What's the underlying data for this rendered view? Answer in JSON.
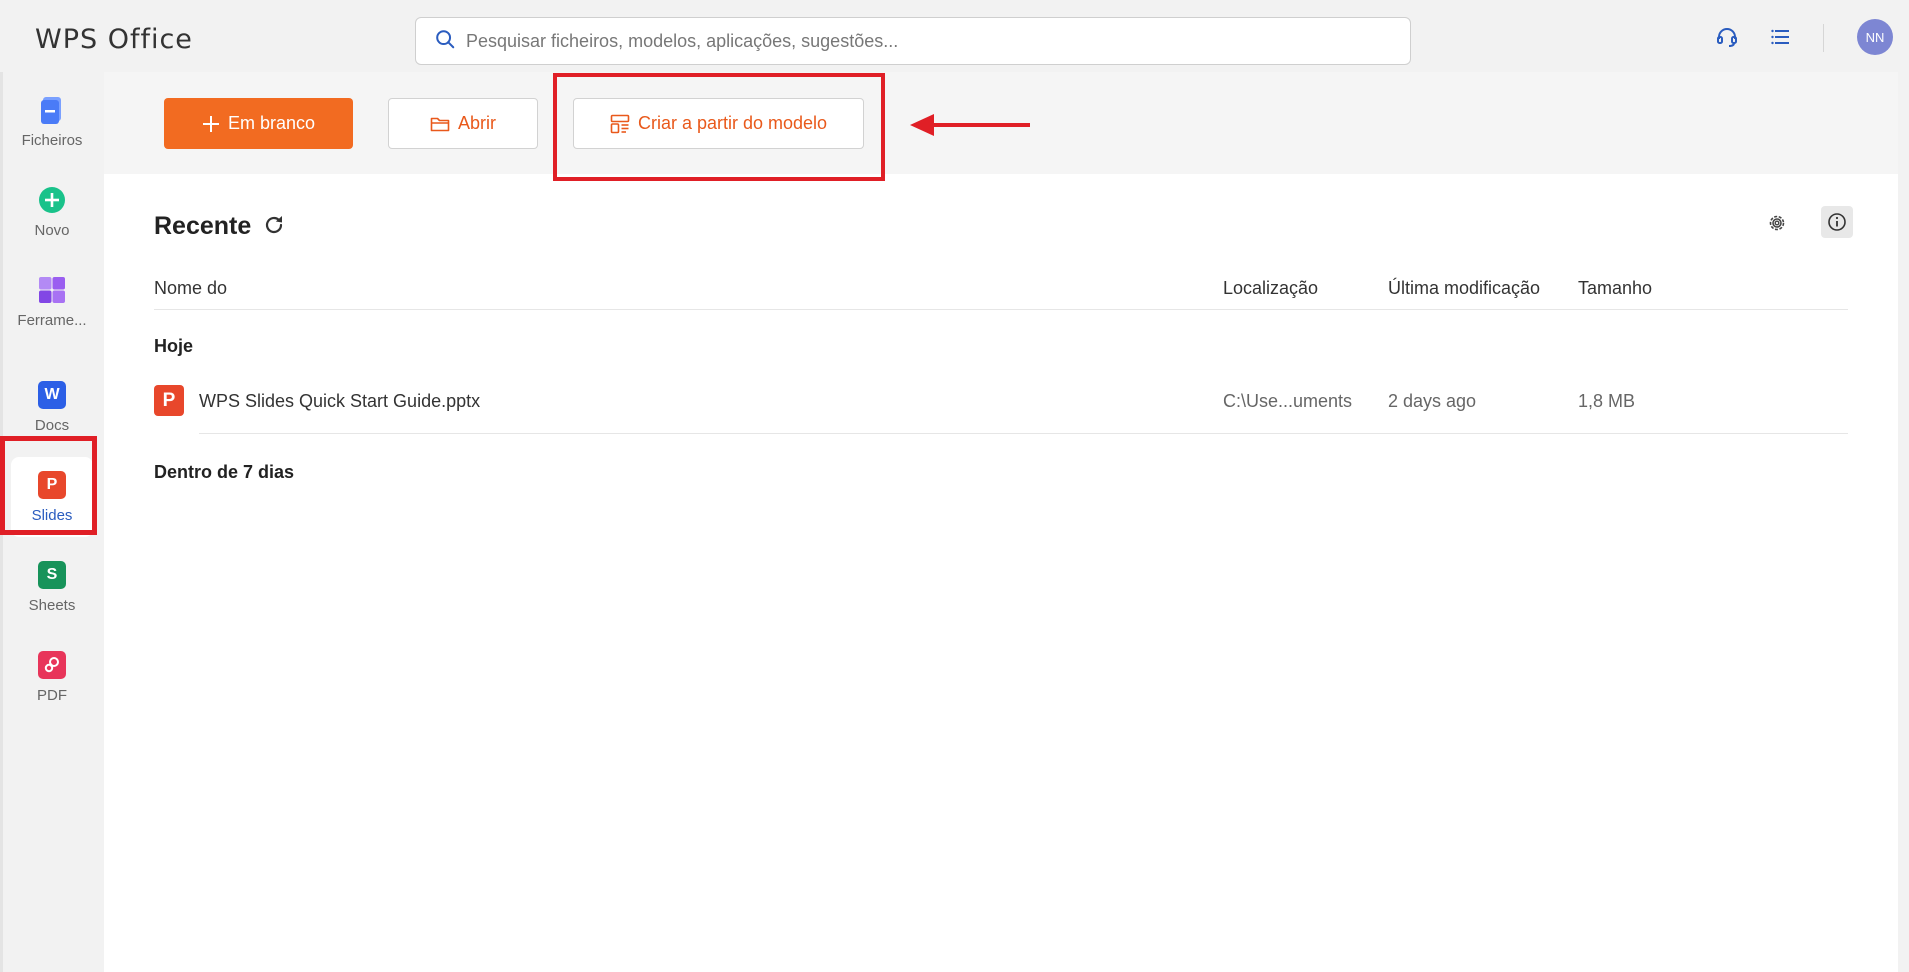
{
  "app": {
    "logo_text": "WPS Office"
  },
  "search": {
    "placeholder": "Pesquisar ficheiros, modelos, aplicações, sugestões..."
  },
  "user": {
    "initials": "NN"
  },
  "sidebar": {
    "items": [
      {
        "label": "Ficheiros",
        "icon": "files-icon",
        "color": "#4a7bf7"
      },
      {
        "label": "Novo",
        "icon": "plus-circle-icon",
        "color": "#19c28a"
      },
      {
        "label": "Ferrame...",
        "icon": "tools-icon",
        "color": "#9a5ef0"
      },
      {
        "label": "Docs",
        "icon": "docs-icon",
        "color": "#2c5fe6",
        "glyph": "W"
      },
      {
        "label": "Slides",
        "icon": "slides-icon",
        "color": "#e8472b",
        "glyph": "P",
        "active": true
      },
      {
        "label": "Sheets",
        "icon": "sheets-icon",
        "color": "#17935a",
        "glyph": "S"
      },
      {
        "label": "PDF",
        "icon": "pdf-icon",
        "color": "#e8355a"
      }
    ]
  },
  "actions": {
    "blank_label": "Em branco",
    "open_label": "Abrir",
    "template_label": "Criar a partir do modelo"
  },
  "recent": {
    "title": "Recente",
    "columns": {
      "name": "Nome do",
      "location": "Localização",
      "modified": "Última modificação",
      "size": "Tamanho"
    },
    "groups": [
      {
        "label": "Hoje",
        "files": [
          {
            "name": "WPS Slides Quick Start Guide.pptx",
            "location": "C:\\Use...uments",
            "modified": "2 days ago",
            "size": "1,8 MB"
          }
        ]
      },
      {
        "label": "Dentro de 7 dias",
        "files": []
      }
    ]
  },
  "colors": {
    "accent": "#f26b21",
    "highlight": "#e01f26",
    "active_nav": "#2a5cbf"
  }
}
